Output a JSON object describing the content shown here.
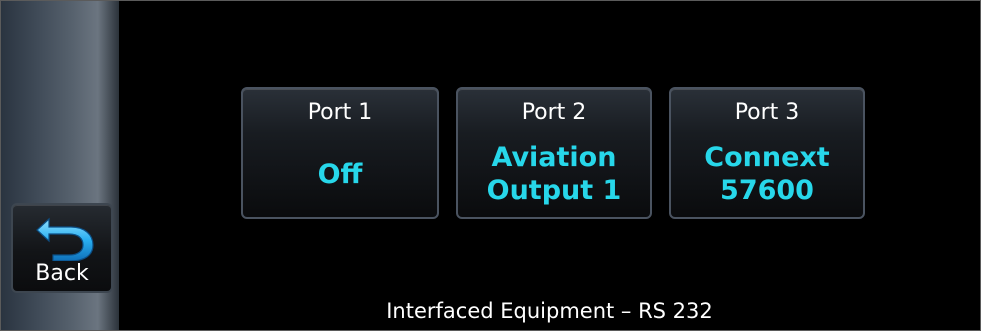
{
  "sidebar": {
    "back_label": "Back",
    "back_icon": "back-arrow-icon"
  },
  "ports": [
    {
      "title": "Port 1",
      "value_lines": [
        "Off"
      ]
    },
    {
      "title": "Port 2",
      "value_lines": [
        "Aviation",
        "Output 1"
      ]
    },
    {
      "title": "Port 3",
      "value_lines": [
        "Connext",
        "57600"
      ]
    }
  ],
  "page_title": "Interfaced Equipment – RS 232",
  "colors": {
    "value_text": "#27d7ea",
    "label_text": "#ffffff",
    "back_icon": "#29aef0",
    "background": "#000000"
  }
}
